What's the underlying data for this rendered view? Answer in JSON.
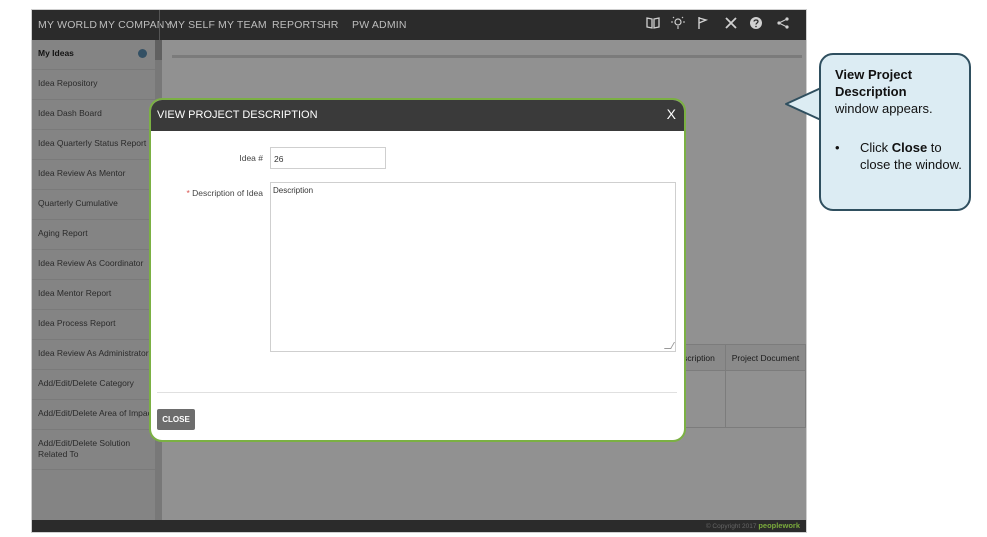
{
  "nav": {
    "items": [
      "MY WORLD",
      "MY COMPANY",
      "MY SELF",
      "MY TEAM",
      "REPORTS",
      "HR",
      "PW ADMIN"
    ],
    "icons": [
      "book-icon",
      "lightbulb-icon",
      "flag-icon",
      "tools-icon",
      "help-icon",
      "share-icon"
    ]
  },
  "sidebar": {
    "items": [
      "My Ideas",
      "Idea Repository",
      "Idea Dash Board",
      "Idea Quarterly Status Report",
      "Idea Review As Mentor",
      "Quarterly Cumulative",
      "Aging Report",
      "Idea Review As Coordinator",
      "Idea Mentor Report",
      "Idea Process Report",
      "Idea Review As Administrator",
      "Add/Edit/Delete Category",
      "Add/Edit/Delete Area of Impact",
      "Add/Edit/Delete Solution Related To"
    ]
  },
  "table": {
    "headers": [
      "scription",
      "Project Document"
    ]
  },
  "footer": {
    "copyright": "© Copyright 2017",
    "brand": "peoplework"
  },
  "modal": {
    "title": "VIEW PROJECT DESCRIPTION",
    "close_x": "X",
    "idea_label": "Idea #",
    "idea_value": "26",
    "required_mark": "*",
    "description_label": "Description of Idea",
    "description_value": "Description",
    "close_button": "CLOSE"
  },
  "callout": {
    "title": "View Project Description",
    "subtitle": "window appears.",
    "bullet": "•",
    "step_prefix": "Click ",
    "step_bold": "Close",
    "step_suffix": " to close the window."
  },
  "colors": {
    "nav_bg": "#2b2b2b",
    "modal_border": "#7bb043",
    "callout_bg": "#dcecf3",
    "callout_border": "#2f4f5f",
    "close_button_bg": "#6d6d6d"
  }
}
